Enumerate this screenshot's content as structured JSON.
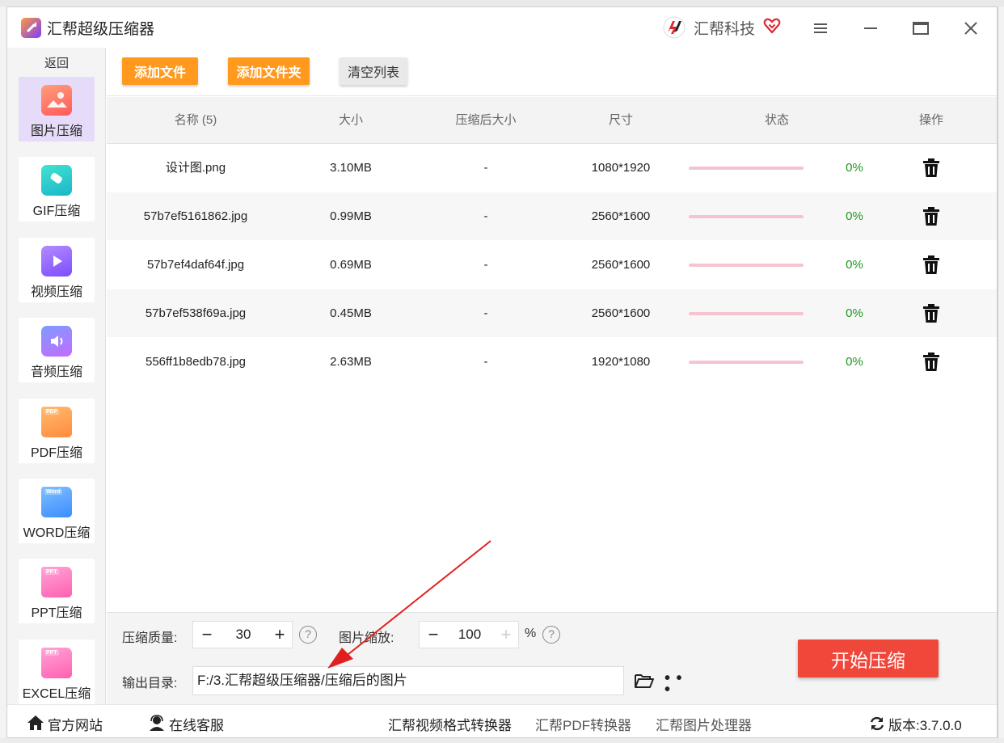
{
  "window": {
    "title": "汇帮超级压缩器",
    "brand": "汇帮科技"
  },
  "sidebar": {
    "back": "返回",
    "items": [
      {
        "label": "图片压缩",
        "icon": "image-icon",
        "active": true
      },
      {
        "label": "GIF压缩",
        "icon": "gif-icon",
        "active": false
      },
      {
        "label": "视频压缩",
        "icon": "video-play-icon",
        "active": false
      },
      {
        "label": "音频压缩",
        "icon": "audio-speaker-icon",
        "active": false
      },
      {
        "label": "PDF压缩",
        "icon": "pdf-file-icon",
        "tag": "PDF",
        "active": false
      },
      {
        "label": "WORD压缩",
        "icon": "word-file-icon",
        "tag": "Word",
        "active": false
      },
      {
        "label": "PPT压缩",
        "icon": "ppt-file-icon",
        "tag": "PPT",
        "active": false
      },
      {
        "label": "EXCEL压缩",
        "icon": "excel-file-icon",
        "tag": "PPT",
        "active": false
      }
    ]
  },
  "toolbar": {
    "add_file": "添加文件",
    "add_folder": "添加文件夹",
    "clear_list": "清空列表"
  },
  "table": {
    "headers": {
      "name": "名称 (5)",
      "size": "大小",
      "compressed_size": "压缩后大小",
      "dimensions": "尺寸",
      "status": "状态",
      "actions": "操作"
    },
    "rows": [
      {
        "name": "设计图.png",
        "size": "3.10MB",
        "compressed": "-",
        "dims": "1080*1920",
        "progress": 0,
        "percent": "0%"
      },
      {
        "name": "57b7ef5161862.jpg",
        "size": "0.99MB",
        "compressed": "-",
        "dims": "2560*1600",
        "progress": 0,
        "percent": "0%"
      },
      {
        "name": "57b7ef4daf64f.jpg",
        "size": "0.69MB",
        "compressed": "-",
        "dims": "2560*1600",
        "progress": 0,
        "percent": "0%"
      },
      {
        "name": "57b7ef538f69a.jpg",
        "size": "0.45MB",
        "compressed": "-",
        "dims": "2560*1600",
        "progress": 0,
        "percent": "0%"
      },
      {
        "name": "556ff1b8edb78.jpg",
        "size": "2.63MB",
        "compressed": "-",
        "dims": "1920*1080",
        "progress": 0,
        "percent": "0%"
      }
    ]
  },
  "settings": {
    "quality_label": "压缩质量:",
    "quality_value": "30",
    "scale_label": "图片缩放:",
    "scale_value": "100",
    "scale_unit": "%",
    "minus": "−",
    "plus": "+",
    "help": "?",
    "output_label": "输出目录:",
    "output_path": "F:/3.汇帮超级压缩器/压缩后的图片",
    "start_button": "开始压缩"
  },
  "footer": {
    "website": "官方网站",
    "support": "在线客服",
    "links": [
      "汇帮视频格式转换器",
      "汇帮PDF转换器",
      "汇帮图片处理器"
    ],
    "version": "版本:3.7.0.0"
  },
  "colors": {
    "accent_orange": "#ff9a1f",
    "start_red": "#f0473b",
    "active_item": "#e6dcf9",
    "percent_green": "#1a9a1a",
    "progress_track": "#f5c4cf",
    "annotation_arrow": "#e02020"
  }
}
